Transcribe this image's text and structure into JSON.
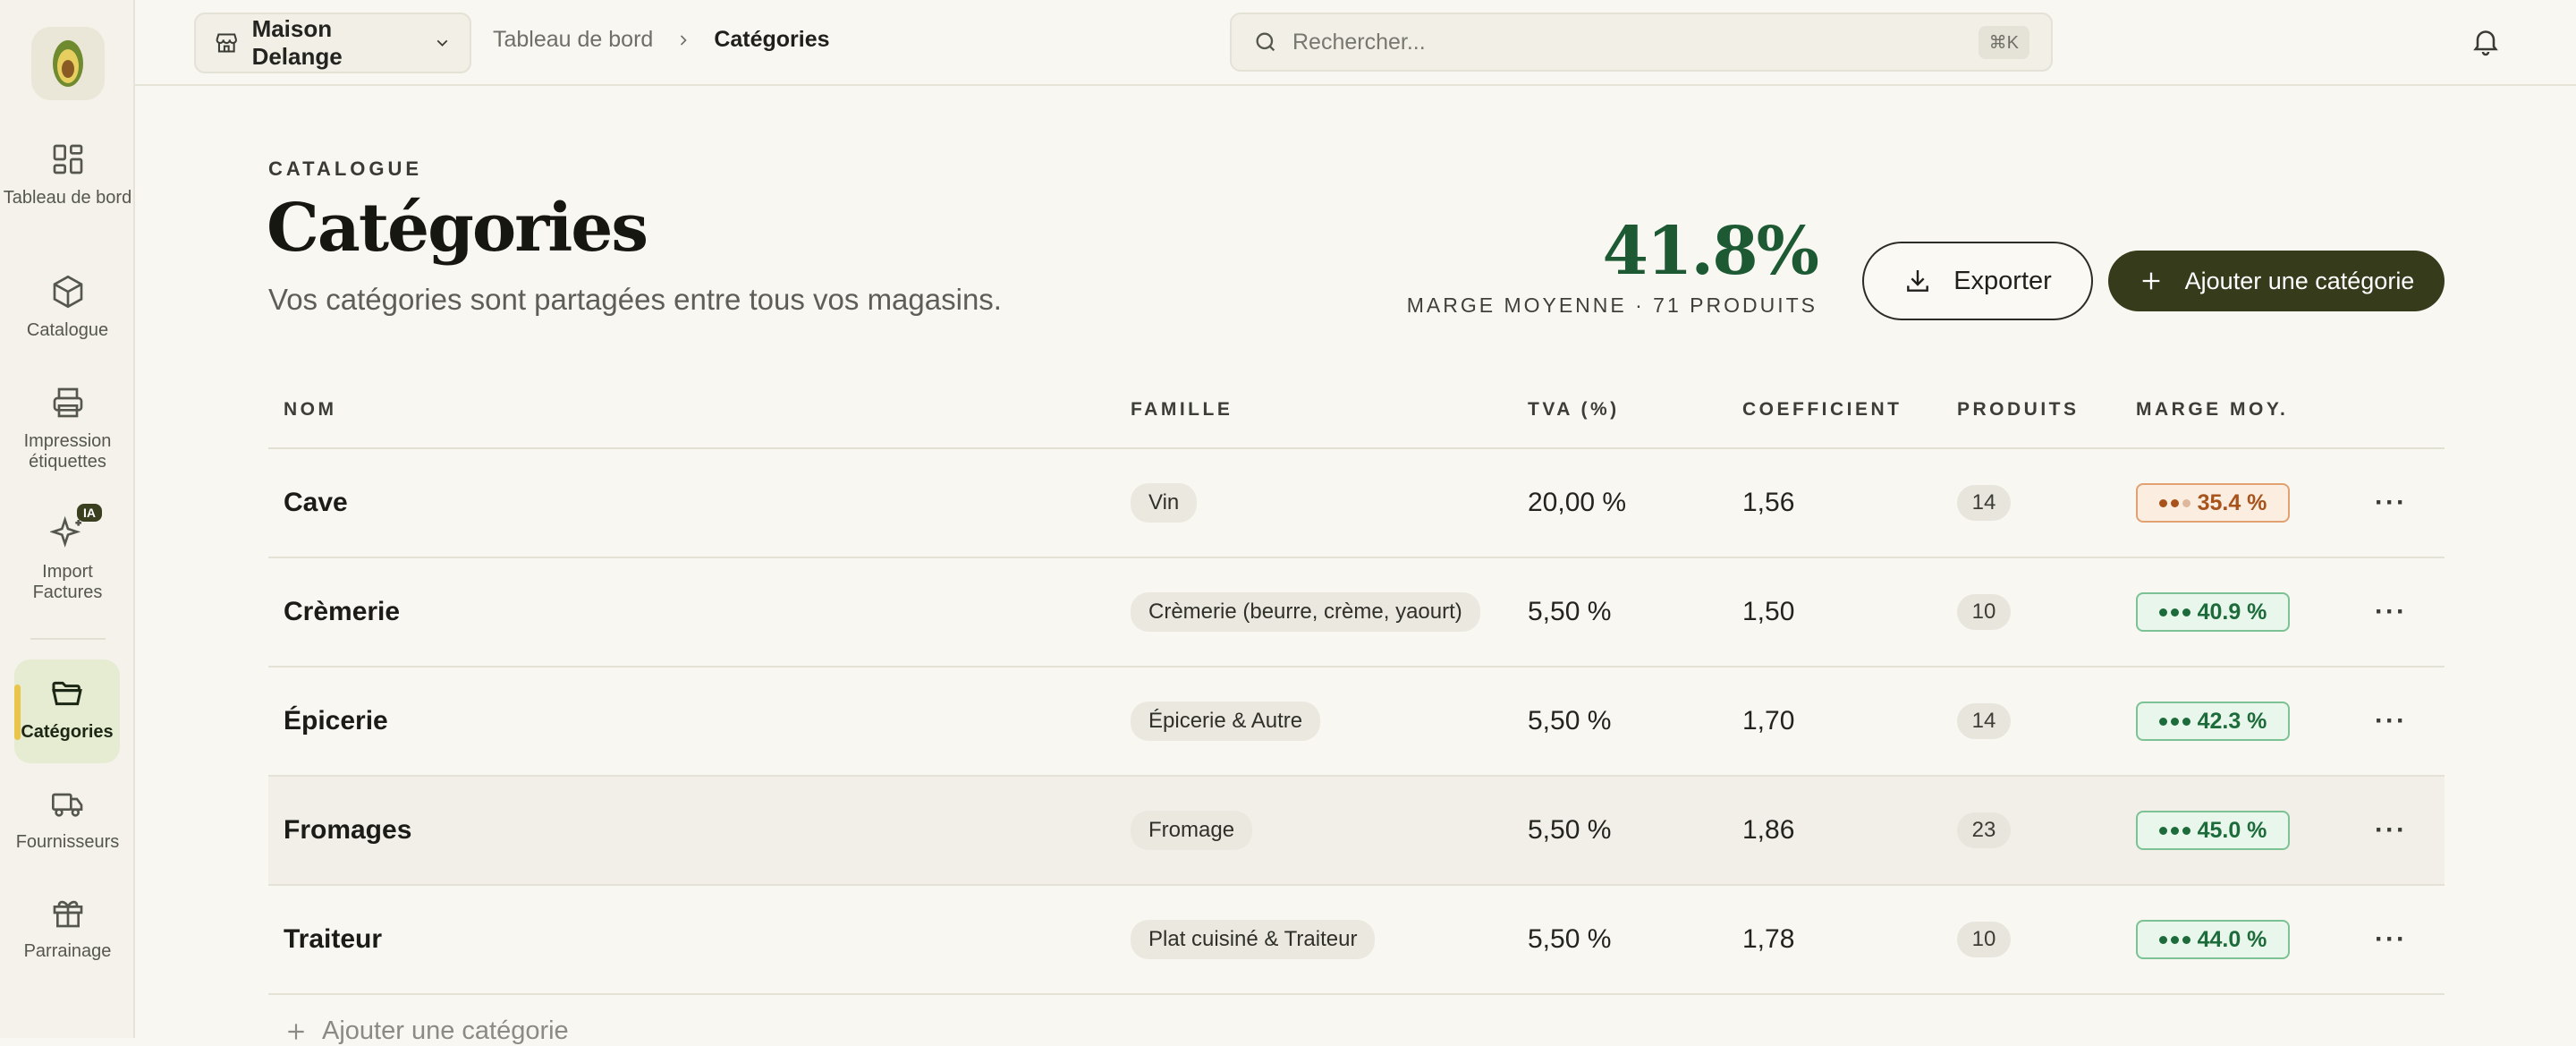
{
  "sidebar": {
    "items": [
      {
        "label": "Tableau de bord",
        "icon": "dashboard-icon"
      },
      {
        "label": "Catalogue",
        "icon": "box-icon"
      },
      {
        "label": "Impression étiquettes",
        "icon": "printer-icon"
      },
      {
        "label": "Import Factures",
        "icon": "sparkles-icon",
        "badge": "IA"
      },
      {
        "label": "Catégories",
        "icon": "folder-icon",
        "active": true
      },
      {
        "label": "Fournisseurs",
        "icon": "truck-icon"
      },
      {
        "label": "Parrainage",
        "icon": "gift-icon"
      }
    ]
  },
  "topbar": {
    "store": "Maison Delange",
    "breadcrumb": [
      "Tableau de bord",
      "Catégories"
    ],
    "search_placeholder": "Rechercher...",
    "search_shortcut": "⌘K"
  },
  "header": {
    "eyebrow": "CATALOGUE",
    "title": "Catégories",
    "subtitle": "Vos catégories sont partagées entre tous vos magasins.",
    "kpi_value": "41.8%",
    "kpi_label": "MARGE MOYENNE · 71 PRODUITS",
    "export_label": "Exporter",
    "add_label": "Ajouter une catégorie"
  },
  "table": {
    "columns": [
      "NOM",
      "FAMILLE",
      "TVA (%)",
      "COEFFICIENT",
      "PRODUITS",
      "MARGE MOY."
    ],
    "rows": [
      {
        "name": "Cave",
        "famille": "Vin",
        "tva": "20,00 %",
        "coef": "1,56",
        "produits": "14",
        "marge": "35.4 %",
        "status": "warn"
      },
      {
        "name": "Crèmerie",
        "famille": "Crèmerie (beurre, crème, yaourt)",
        "tva": "5,50 %",
        "coef": "1,50",
        "produits": "10",
        "marge": "40.9 %",
        "status": "good"
      },
      {
        "name": "Épicerie",
        "famille": "Épicerie & Autre",
        "tva": "5,50 %",
        "coef": "1,70",
        "produits": "14",
        "marge": "42.3 %",
        "status": "good"
      },
      {
        "name": "Fromages",
        "famille": "Fromage",
        "tva": "5,50 %",
        "coef": "1,86",
        "produits": "23",
        "marge": "45.0 %",
        "status": "good"
      },
      {
        "name": "Traiteur",
        "famille": "Plat cuisiné & Traiteur",
        "tva": "5,50 %",
        "coef": "1,78",
        "produits": "10",
        "marge": "44.0 %",
        "status": "good"
      }
    ],
    "add_row_label": "Ajouter une catégorie"
  },
  "colors": {
    "accent": "#363b1c",
    "good": "#1d6b3a",
    "warn": "#a8521c",
    "active_nav": "#e6ecd1"
  }
}
